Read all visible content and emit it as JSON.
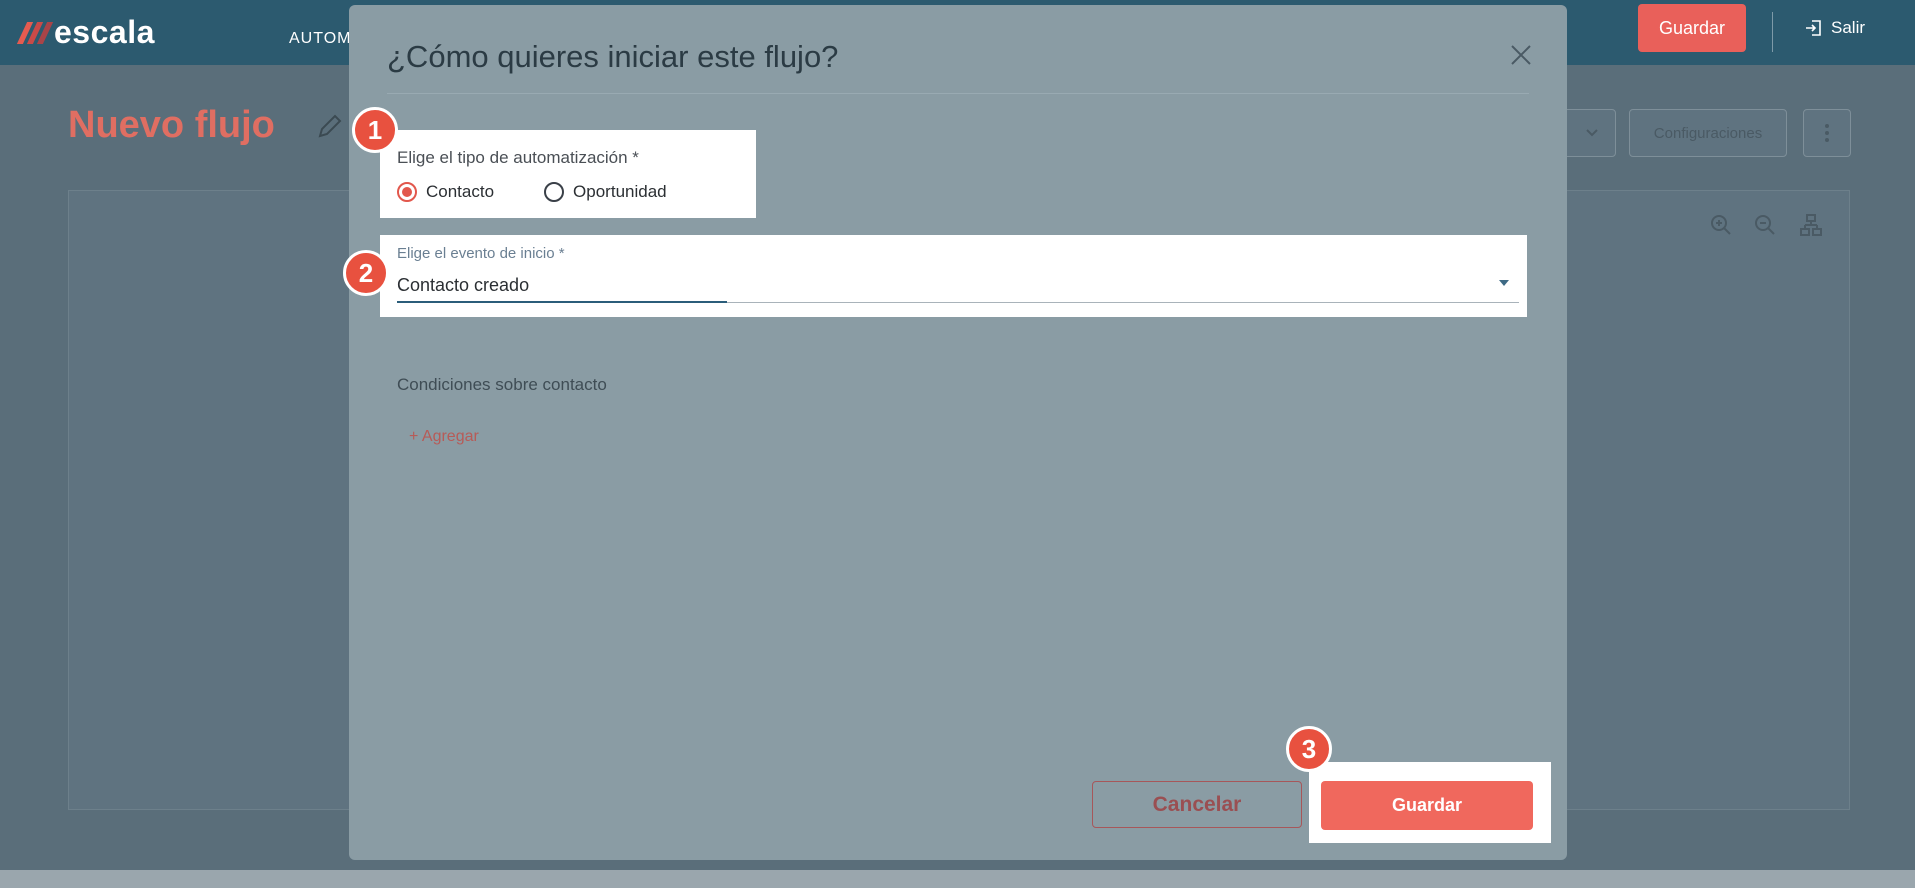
{
  "app": {
    "logo_text": "escala",
    "nav_item": "AUTOM",
    "save_label": "Guardar",
    "exit_label": "Salir",
    "page_title": "Nuevo flujo",
    "config_label": "Configuraciones"
  },
  "modal": {
    "title": "¿Cómo quieres iniciar este flujo?",
    "automation_type": {
      "label": "Elige el tipo de automatización *",
      "options": [
        "Contacto",
        "Oportunidad"
      ],
      "selected": "Contacto"
    },
    "start_event": {
      "label": "Elige el evento de inicio *",
      "value": "Contacto creado"
    },
    "conditions_label": "Condiciones sobre contacto",
    "add_label": "+ Agregar",
    "cancel_label": "Cancelar",
    "save_label": "Guardar"
  },
  "steps": [
    "1",
    "2",
    "3"
  ],
  "colors": {
    "accent": "#f0685d",
    "step_badge": "#e8513f",
    "topbar": "#2c5a6f"
  }
}
